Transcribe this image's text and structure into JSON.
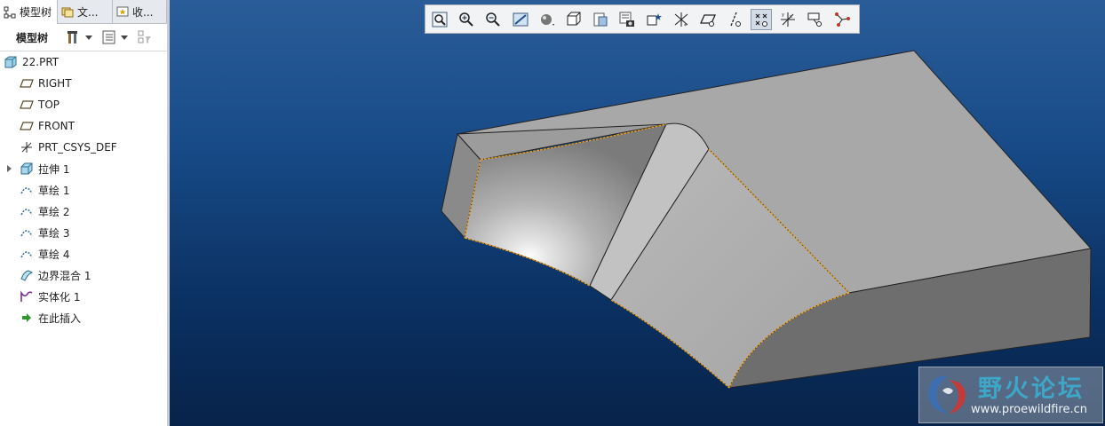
{
  "tabs": [
    {
      "label": "模型树",
      "icon": "model-tree-icon",
      "active": true
    },
    {
      "label": "文...",
      "icon": "folder-browser-icon",
      "active": false
    },
    {
      "label": "收...",
      "icon": "favorites-icon",
      "active": false
    }
  ],
  "tree_toolbar": {
    "title": "模型树",
    "settings_icon": "tree-settings-icon",
    "show_icon": "tree-show-icon",
    "filter_icon": "tree-filter-icon"
  },
  "tree": {
    "root": {
      "label": "22.PRT",
      "icon": "part-icon"
    },
    "items": [
      {
        "label": "RIGHT",
        "icon": "datum-plane-icon"
      },
      {
        "label": "TOP",
        "icon": "datum-plane-icon"
      },
      {
        "label": "FRONT",
        "icon": "datum-plane-icon"
      },
      {
        "label": "PRT_CSYS_DEF",
        "icon": "coordinate-system-icon"
      },
      {
        "label": "拉伸 1",
        "icon": "extrude-icon",
        "expandable": true
      },
      {
        "label": "草绘 1",
        "icon": "sketch-icon"
      },
      {
        "label": "草绘 2",
        "icon": "sketch-icon"
      },
      {
        "label": "草绘 3",
        "icon": "sketch-icon"
      },
      {
        "label": "草绘 4",
        "icon": "sketch-icon"
      },
      {
        "label": "边界混合 1",
        "icon": "boundary-blend-icon"
      },
      {
        "label": "实体化 1",
        "icon": "solidify-icon"
      },
      {
        "label": "在此插入",
        "icon": "insert-here-arrow-icon"
      }
    ]
  },
  "view_toolbar": [
    {
      "icon": "refit-zoom-icon"
    },
    {
      "icon": "zoom-in-icon"
    },
    {
      "icon": "zoom-out-icon"
    },
    {
      "icon": "repaint-icon"
    },
    {
      "icon": "display-style-icon"
    },
    {
      "icon": "saved-orientations-icon"
    },
    {
      "icon": "view-manager-icon"
    },
    {
      "icon": "appearance-gallery-icon"
    },
    {
      "icon": "perspective-view-icon"
    },
    {
      "icon": "datum-display-icon"
    },
    {
      "icon": "plane-display-icon"
    },
    {
      "icon": "axis-display-icon"
    },
    {
      "icon": "point-display-icon",
      "pressed": true
    },
    {
      "icon": "csys-display-icon"
    },
    {
      "icon": "annotation-display-icon"
    },
    {
      "icon": "spin-center-icon"
    }
  ],
  "colors": {
    "viewport_top": "#2a5d98",
    "viewport_bottom": "#07234a",
    "edge_highlight": "#e8a32a",
    "model_gray": "#a7a7a7"
  },
  "watermark": {
    "title": "野火论坛",
    "url": "www.proewildfire.cn"
  }
}
